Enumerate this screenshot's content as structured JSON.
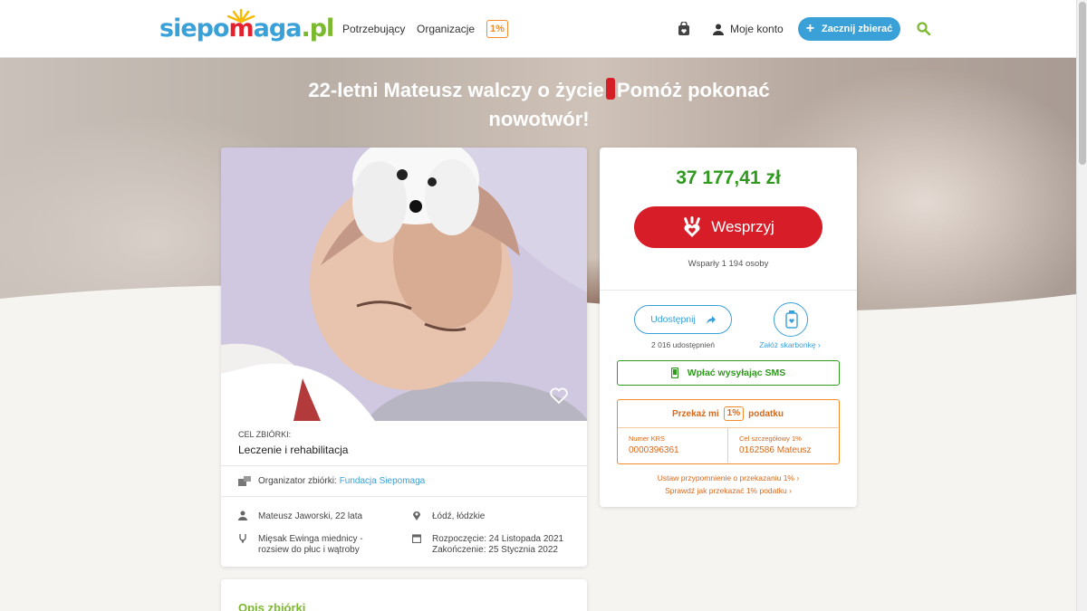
{
  "header": {
    "logo": {
      "p1": "siepo",
      "p2": "m",
      "p3": "aga",
      "p4": ".pl"
    },
    "nav_potrzebujacy": "Potrzebujący",
    "nav_organizacje": "Organizacje",
    "nav_1pct": "1%",
    "account_label": "Moje konto",
    "start_button": "Zacznij zbierać",
    "icons": [
      "bag-icon",
      "user-icon",
      "plus-icon",
      "search-icon"
    ]
  },
  "hero": {
    "title_part1": "22-letni Mateusz walczy o życie",
    "title_part2": "Pomóż pokonać nowotwór!"
  },
  "fundraiser": {
    "goal_label": "CEL ZBIÓRKI:",
    "goal_value": "Leczenie i rehabilitacja",
    "organizer_label": "Organizator zbiórki:",
    "organizer_name": "Fundacja Siepomaga",
    "person": "Mateusz Jaworski, 22 lata",
    "location": "Łódź, łódzkie",
    "diagnosis": "Mięsak Ewinga miednicy - rozsiew do płuc i wątroby",
    "start_date": "Rozpoczęcie: 24 Listopada 2021",
    "end_date": "Zakończenie: 25 Stycznia 2022"
  },
  "support": {
    "amount": "37 177,41 zł",
    "support_button": "Wesprzyj",
    "supporters": "Wsparły 1 194 osoby",
    "share_button": "Udostępnij",
    "shares": "2 016 udostępnień",
    "piggy_link": "Załóż skarbonkę",
    "sms_button": "Wpłać wysyłając SMS",
    "tax_title_before": "Przekaż mi",
    "tax_1pct": "1%",
    "tax_title_after": "podatku",
    "krs_label": "Numer KRS",
    "krs_value": "0000396361",
    "goal_label": "Cel szczegółowy 1%",
    "goal_value": "0162586 Mateusz",
    "reminder_link": "Ustaw przypomnienie o przekazaniu 1%",
    "howto_link": "Sprawdź jak przekazać 1% podatku"
  },
  "description": {
    "title": "Opis zbiórki"
  },
  "colors": {
    "brand_blue": "#3aa0d8",
    "brand_red": "#d71d28",
    "brand_green": "#2f9a1e",
    "tax_orange": "#f28b2b"
  }
}
